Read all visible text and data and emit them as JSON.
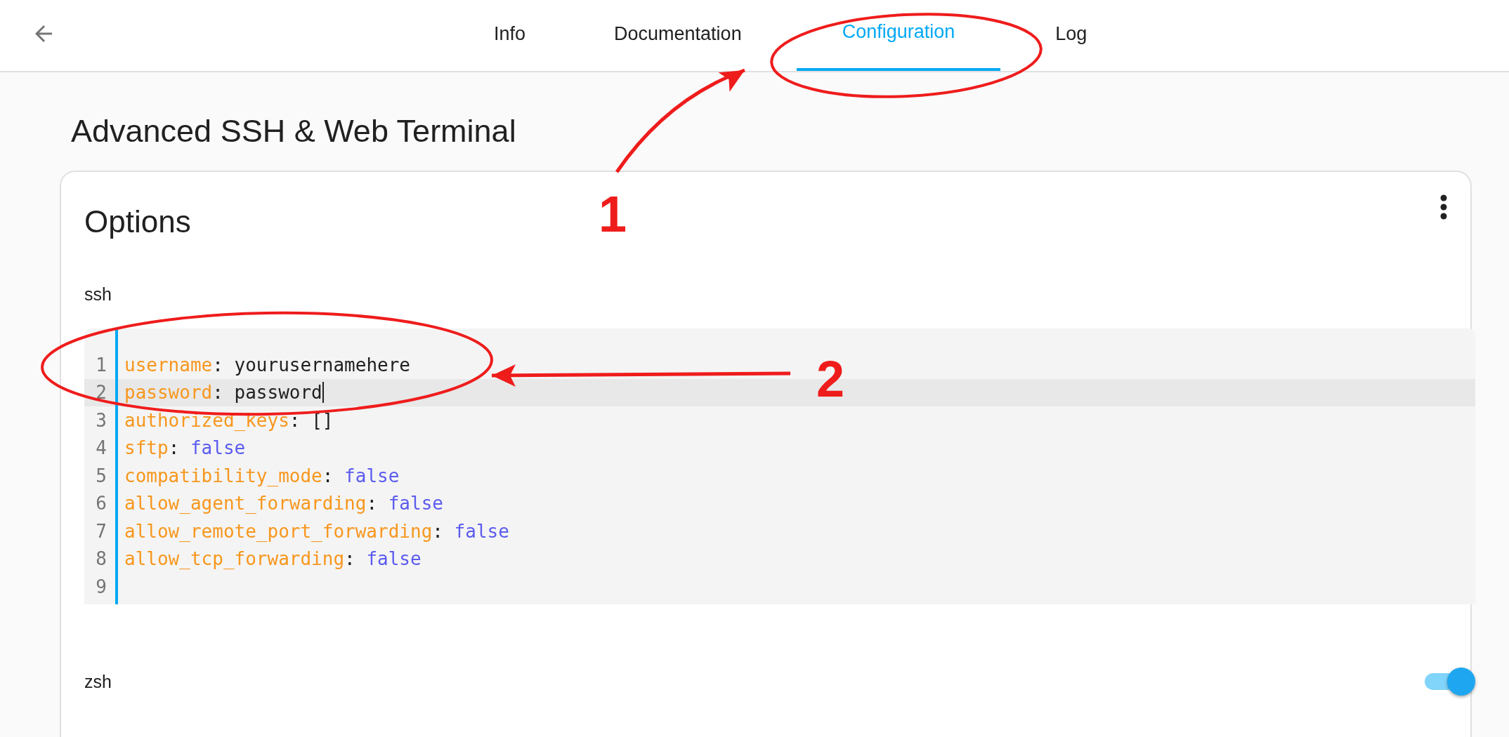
{
  "header": {
    "tabs": [
      {
        "label": "Info",
        "selected": false
      },
      {
        "label": "Documentation",
        "selected": false
      },
      {
        "label": "Configuration",
        "selected": true
      },
      {
        "label": "Log",
        "selected": false
      }
    ]
  },
  "page_title": "Advanced SSH & Web Terminal",
  "card": {
    "title": "Options",
    "ssh": {
      "label": "ssh",
      "lines": [
        {
          "number": "1",
          "active": false,
          "tokens": [
            {
              "text": "username",
              "kind": "key"
            },
            {
              "text": ": ",
              "kind": "punct"
            },
            {
              "text": "yourusernamehere",
              "kind": "string"
            }
          ]
        },
        {
          "number": "2",
          "active": true,
          "tokens": [
            {
              "text": "password",
              "kind": "key"
            },
            {
              "text": ": ",
              "kind": "punct"
            },
            {
              "text": "password",
              "kind": "string"
            }
          ]
        },
        {
          "number": "3",
          "active": false,
          "tokens": [
            {
              "text": "authorized_keys",
              "kind": "key"
            },
            {
              "text": ": ",
              "kind": "punct"
            },
            {
              "text": "[]",
              "kind": "punct"
            }
          ]
        },
        {
          "number": "4",
          "active": false,
          "tokens": [
            {
              "text": "sftp",
              "kind": "key"
            },
            {
              "text": ": ",
              "kind": "punct"
            },
            {
              "text": "false",
              "kind": "literal"
            }
          ]
        },
        {
          "number": "5",
          "active": false,
          "tokens": [
            {
              "text": "compatibility_mode",
              "kind": "key"
            },
            {
              "text": ": ",
              "kind": "punct"
            },
            {
              "text": "false",
              "kind": "literal"
            }
          ]
        },
        {
          "number": "6",
          "active": false,
          "tokens": [
            {
              "text": "allow_agent_forwarding",
              "kind": "key"
            },
            {
              "text": ": ",
              "kind": "punct"
            },
            {
              "text": "false",
              "kind": "literal"
            }
          ]
        },
        {
          "number": "7",
          "active": false,
          "tokens": [
            {
              "text": "allow_remote_port_forwarding",
              "kind": "key"
            },
            {
              "text": ": ",
              "kind": "punct"
            },
            {
              "text": "false",
              "kind": "literal"
            }
          ]
        },
        {
          "number": "8",
          "active": false,
          "tokens": [
            {
              "text": "allow_tcp_forwarding",
              "kind": "key"
            },
            {
              "text": ": ",
              "kind": "punct"
            },
            {
              "text": "false",
              "kind": "literal"
            }
          ]
        },
        {
          "number": "9",
          "active": false
        }
      ]
    },
    "zsh": {
      "label": "zsh",
      "on": true
    }
  },
  "annotations": [
    {
      "kind": "ellipse"
    },
    {
      "kind": "arrow"
    },
    {
      "kind": "label",
      "text": "1"
    },
    {
      "kind": "ellipse"
    },
    {
      "kind": "arrow"
    },
    {
      "kind": "label",
      "text": "2"
    }
  ]
}
